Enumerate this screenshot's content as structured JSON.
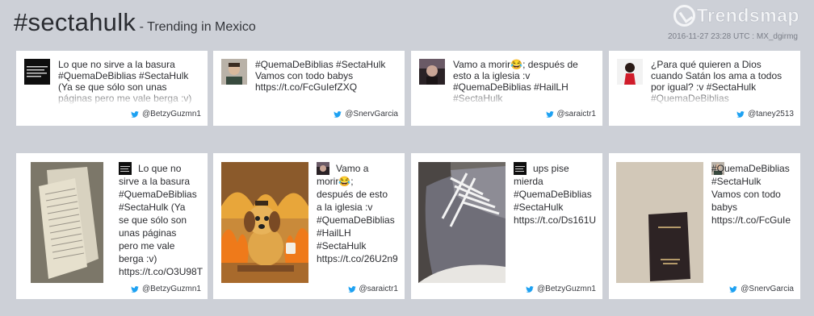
{
  "header": {
    "hashtag": "#sectahulk",
    "subtitle": " - Trending in Mexico",
    "logo_text": "Trendsmap",
    "timestamp": "2016-11-27 23:28 UTC : MX_dgirmg"
  },
  "top_cards": [
    {
      "text": "Lo que no sirve a la basura\n#QuemaDeBiblias #SectaHulk\n(Ya se que sólo son unas\npáginas pero me vale berga :v)",
      "handle": "@BetzyGuzmn1"
    },
    {
      "text": "#QuemaDeBiblias #SectaHulk\nVamos con todo babys\nhttps://t.co/FcGuIefZXQ",
      "handle": "@SnervGarcia"
    },
    {
      "text": "Vamo a morir😂; después de\nesto a la iglesia :v\n#QuemaDeBiblias #HailLH\n#SectaHulk",
      "handle": "@saraictr1"
    },
    {
      "text": "¿Para qué quieren a Dios\ncuando Satán los ama a todos\npor igual? :v #SectaHulk\n#QuemaDeBiblias",
      "handle": "@taney2513"
    }
  ],
  "media_cards": [
    {
      "text": "Lo que no\nsirve a la basura\n#QuemaDeBiblias\n#SectaHulk (Ya\nse que sólo son\nunas páginas\npero me vale\nberga :v)\nhttps://t.co/O3U98T",
      "handle": "@BetzyGuzmn1",
      "media_icon": "torn-pages-photo"
    },
    {
      "text": "Vamo a\nmorir😂;\ndespués de esto\na la iglesia :v\n#QuemaDeBiblias\n#HailLH\n#SectaHulk\nhttps://t.co/26U2n9",
      "handle": "@saraictr1",
      "media_icon": "this-is-fine-dog-cartoon"
    },
    {
      "text": "ups pise\nmierda\n#QuemaDeBiblias\n#SectaHulk\nhttps://t.co/Ds161U",
      "handle": "@BetzyGuzmn1",
      "media_icon": "sneaker-photo"
    },
    {
      "text": "#QuemaDeBiblias\n#SectaHulk\nVamos con todo\nbabys\nhttps://t.co/FcGuIe",
      "handle": "@SnervGarcia",
      "media_icon": "bible-book-photo"
    }
  ],
  "colors": {
    "background": "#cdd0d7",
    "card": "#ffffff",
    "twitter_blue": "#1da1f2"
  }
}
